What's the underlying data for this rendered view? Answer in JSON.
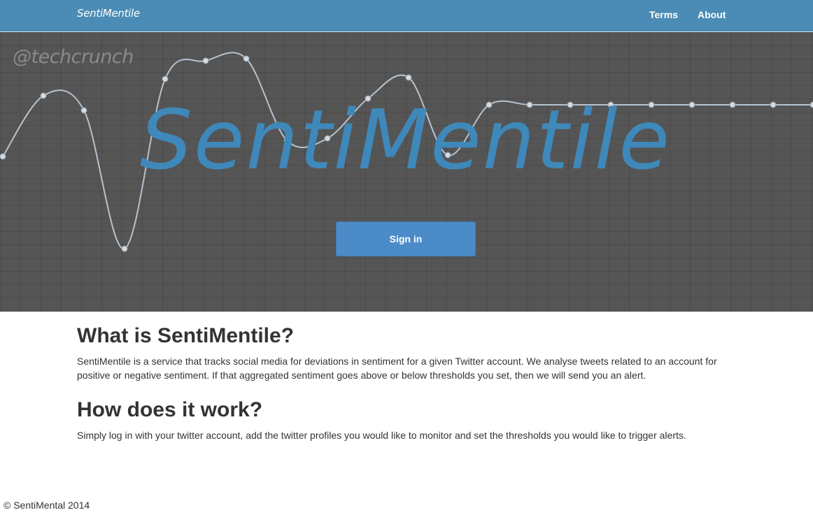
{
  "navbar": {
    "brand": "SentiMentile",
    "links": [
      "Terms",
      "About"
    ],
    "color": "#4a8cb5"
  },
  "hero": {
    "handle": "@techcrunch",
    "logo_text": "SentiMentile",
    "signin_label": "Sign in",
    "logo_color": "#3f88ba",
    "line_color": "#b0c4d4"
  },
  "content": {
    "sections": [
      {
        "heading": "What is SentiMentile?",
        "body": "SentiMentile is a service that tracks social media for deviations in sentiment for a given Twitter account. We analyse tweets related to an account for positive or negative sentiment. If that aggregated sentiment goes above or below thresholds you set, then we will send you an alert."
      },
      {
        "heading": "How does it work?",
        "body": "Simply log in with your twitter account, add the twitter profiles you would like to monitor and set the thresholds you would like to trigger alerts."
      }
    ]
  },
  "footer": {
    "text": "© SentiMental 2014"
  }
}
